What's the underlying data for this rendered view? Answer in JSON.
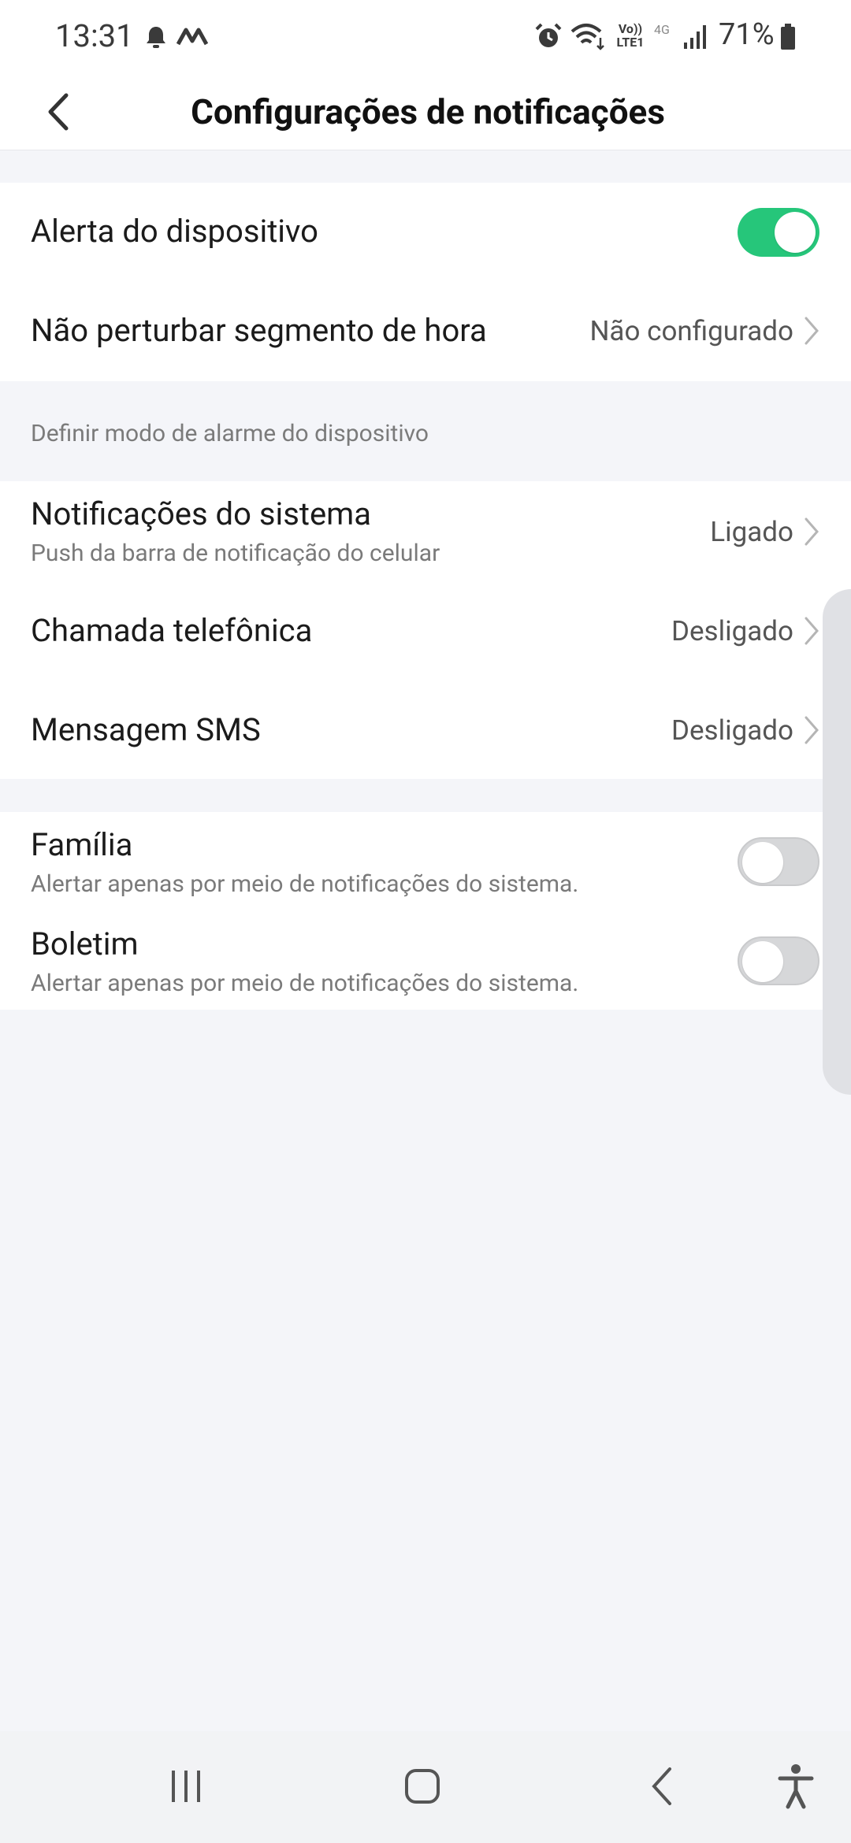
{
  "status_bar": {
    "time": "13:31",
    "icons": [
      "bell-icon",
      "m-logo-icon",
      "alarm-icon",
      "wifi-icon",
      "volte-icon",
      "4g-icon",
      "signal-icon",
      "battery-icon"
    ],
    "volte_top": "Vo))",
    "volte_bottom": "LTE1",
    "network": "4G",
    "battery": "71%"
  },
  "header": {
    "title": "Configurações de notificações",
    "back_icon": "chevron-left-icon"
  },
  "device_section": {
    "alert": {
      "label": "Alerta do dispositivo",
      "enabled": true
    },
    "dnd": {
      "label": "Não perturbar segmento de hora",
      "value": "Não configurado"
    }
  },
  "alarm_mode_section": {
    "title": "Definir modo de alarme do dispositivo",
    "items": [
      {
        "label": "Notificações do sistema",
        "subtitle": "Push da barra de notificação do celular",
        "value": "Ligado"
      },
      {
        "label": "Chamada telefônica",
        "value": "Desligado"
      },
      {
        "label": "Mensagem SMS",
        "value": "Desligado"
      }
    ]
  },
  "categories_section": {
    "items": [
      {
        "label": "Família",
        "subtitle": "Alertar apenas por meio de notificações do sistema.",
        "enabled": false
      },
      {
        "label": "Boletim",
        "subtitle": "Alertar apenas por meio de notificações do sistema.",
        "enabled": false
      }
    ]
  },
  "nav_bar": {
    "icons": [
      "recents-icon",
      "home-icon",
      "back-icon",
      "accessibility-icon"
    ]
  },
  "colors": {
    "accent_green": "#26c67a",
    "background": "#f4f5f9",
    "card": "#ffffff"
  }
}
